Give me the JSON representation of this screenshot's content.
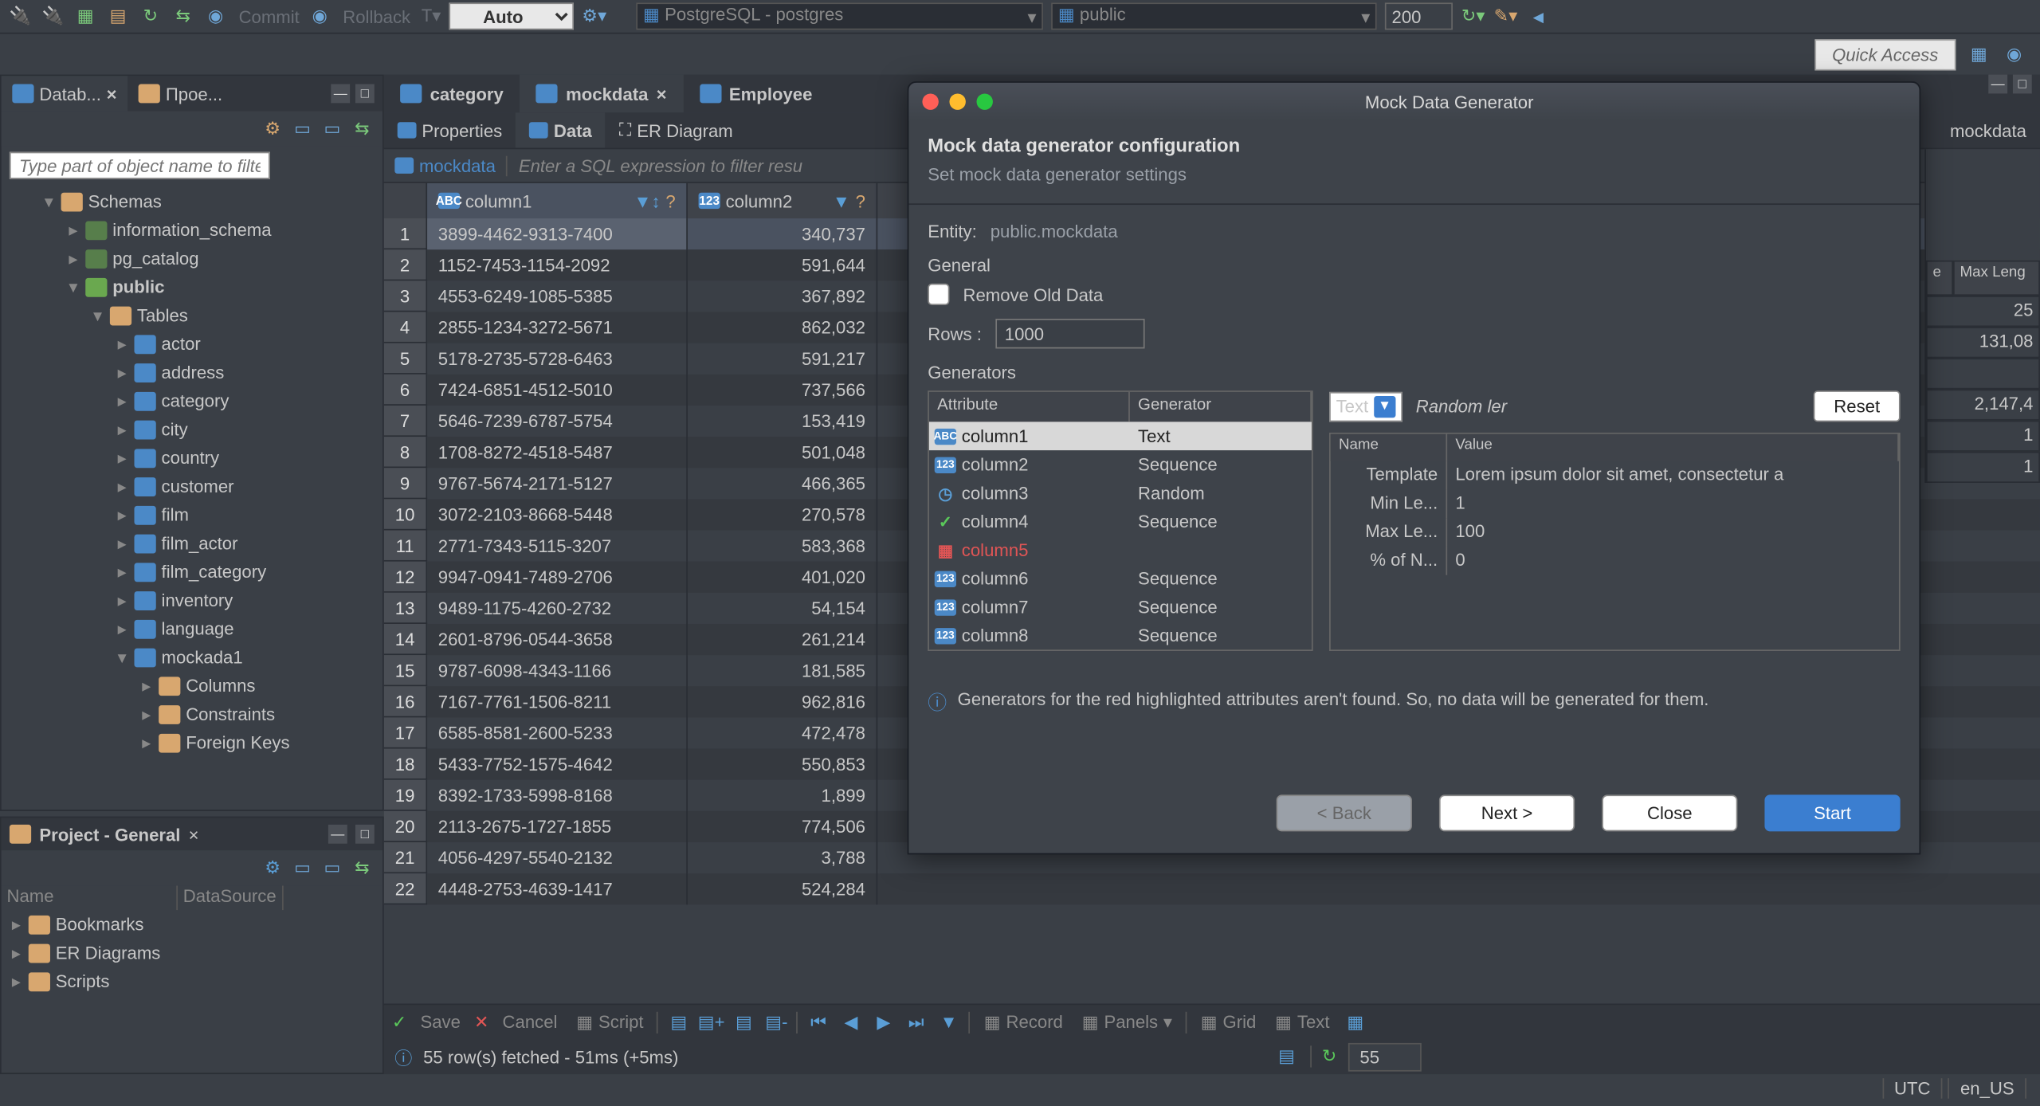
{
  "toolbar": {
    "commit": "Commit",
    "rollback": "Rollback",
    "auto": "Auto",
    "datasource": "PostgreSQL - postgres",
    "schema": "public",
    "limit": "200",
    "quick_access": "Quick Access"
  },
  "nav_tabs": {
    "database": "Datab...",
    "projects": "Прое..."
  },
  "filter_placeholder": "Type part of object name to filter",
  "tree": {
    "schemas": "Schemas",
    "information_schema": "information_schema",
    "pg_catalog": "pg_catalog",
    "public": "public",
    "tables": "Tables",
    "items": [
      "actor",
      "address",
      "category",
      "city",
      "country",
      "customer",
      "film",
      "film_actor",
      "film_category",
      "inventory",
      "language",
      "mockada1"
    ],
    "sub": [
      "Columns",
      "Constraints",
      "Foreign Keys"
    ]
  },
  "project": {
    "title": "Project - General",
    "cols": {
      "name": "Name",
      "ds": "DataSource"
    },
    "items": [
      "Bookmarks",
      "ER Diagrams",
      "Scripts"
    ]
  },
  "editor_tabs": [
    "category",
    "mockdata",
    "Employee"
  ],
  "editor_tabs_right": "mockdata",
  "sub_tabs": {
    "properties": "Properties",
    "data": "Data",
    "er": "ER Diagram"
  },
  "filter": {
    "table": "mockdata",
    "placeholder": "Enter a SQL expression to filter resu"
  },
  "columns": [
    "column1",
    "column2"
  ],
  "rows": [
    [
      "3899-4462-9313-7400",
      "340,737"
    ],
    [
      "1152-7453-1154-2092",
      "591,644"
    ],
    [
      "4553-6249-1085-5385",
      "367,892"
    ],
    [
      "2855-1234-3272-5671",
      "862,032"
    ],
    [
      "5178-2735-5728-6463",
      "591,217"
    ],
    [
      "7424-6851-4512-5010",
      "737,566"
    ],
    [
      "5646-7239-6787-5754",
      "153,419"
    ],
    [
      "1708-8272-4518-5487",
      "501,048"
    ],
    [
      "9767-5674-2171-5127",
      "466,365"
    ],
    [
      "3072-2103-8668-5448",
      "270,578"
    ],
    [
      "2771-7343-5115-3207",
      "583,368"
    ],
    [
      "9947-0941-7489-2706",
      "401,020"
    ],
    [
      "9489-1175-4260-2732",
      "54,154"
    ],
    [
      "2601-8796-0544-3658",
      "261,214"
    ],
    [
      "9787-6098-4343-1166",
      "181,585"
    ],
    [
      "7167-7761-1506-8211",
      "962,816"
    ],
    [
      "6585-8581-2600-5233",
      "472,478"
    ],
    [
      "5433-7752-1575-4642",
      "550,853"
    ],
    [
      "8392-1733-5998-8168",
      "1,899"
    ],
    [
      "2113-2675-1727-1855",
      "774,506"
    ],
    [
      "4056-4297-5540-2132",
      "3,788"
    ],
    [
      "4448-2753-4639-1417",
      "524,284"
    ]
  ],
  "grid_bottom": {
    "save": "Save",
    "cancel": "Cancel",
    "script": "Script",
    "record": "Record",
    "panels": "Panels",
    "grid": "Grid",
    "text": "Text"
  },
  "status": {
    "msg": "55 row(s) fetched - 51ms (+5ms)",
    "count": "55"
  },
  "right_panel": {
    "h1": "e",
    "h2": "Max Leng",
    "vals": [
      "25",
      "131,08",
      "",
      "2,147,4",
      "1",
      "1"
    ]
  },
  "footer": {
    "tz": "UTC",
    "locale": "en_US"
  },
  "dialog": {
    "title": "Mock Data Generator",
    "header": "Mock data generator configuration",
    "sub": "Set mock data generator settings",
    "entity_label": "Entity:",
    "entity_value": "public.mockdata",
    "general": "General",
    "remove_old": "Remove Old Data",
    "rows_label": "Rows :",
    "rows_value": "1000",
    "generators_label": "Generators",
    "gen_head": {
      "attr": "Attribute",
      "gen": "Generator"
    },
    "gen_rows": [
      {
        "icon": "abc",
        "name": "column1",
        "gen": "Text",
        "sel": true
      },
      {
        "icon": "num",
        "name": "column2",
        "gen": "Sequence"
      },
      {
        "icon": "clk",
        "name": "column3",
        "gen": "Random"
      },
      {
        "icon": "chk",
        "name": "column4",
        "gen": "Sequence"
      },
      {
        "icon": "err",
        "name": "column5",
        "gen": "",
        "err": true
      },
      {
        "icon": "num",
        "name": "column6",
        "gen": "Sequence"
      },
      {
        "icon": "num",
        "name": "column7",
        "gen": "Sequence"
      },
      {
        "icon": "num",
        "name": "column8",
        "gen": "Sequence"
      }
    ],
    "combo_value": "Text",
    "combo_desc": "Random ler",
    "reset": "Reset",
    "props_head": {
      "name": "Name",
      "value": "Value"
    },
    "props": [
      [
        "Template",
        "Lorem ipsum dolor sit amet, consectetur a"
      ],
      [
        "Min Le...",
        "1"
      ],
      [
        "Max Le...",
        "100"
      ],
      [
        "% of N...",
        "0"
      ]
    ],
    "info": "Generators for the red highlighted attributes aren't found. So, no data will be generated for them.",
    "btn_back": "< Back",
    "btn_next": "Next >",
    "btn_close": "Close",
    "btn_start": "Start"
  }
}
